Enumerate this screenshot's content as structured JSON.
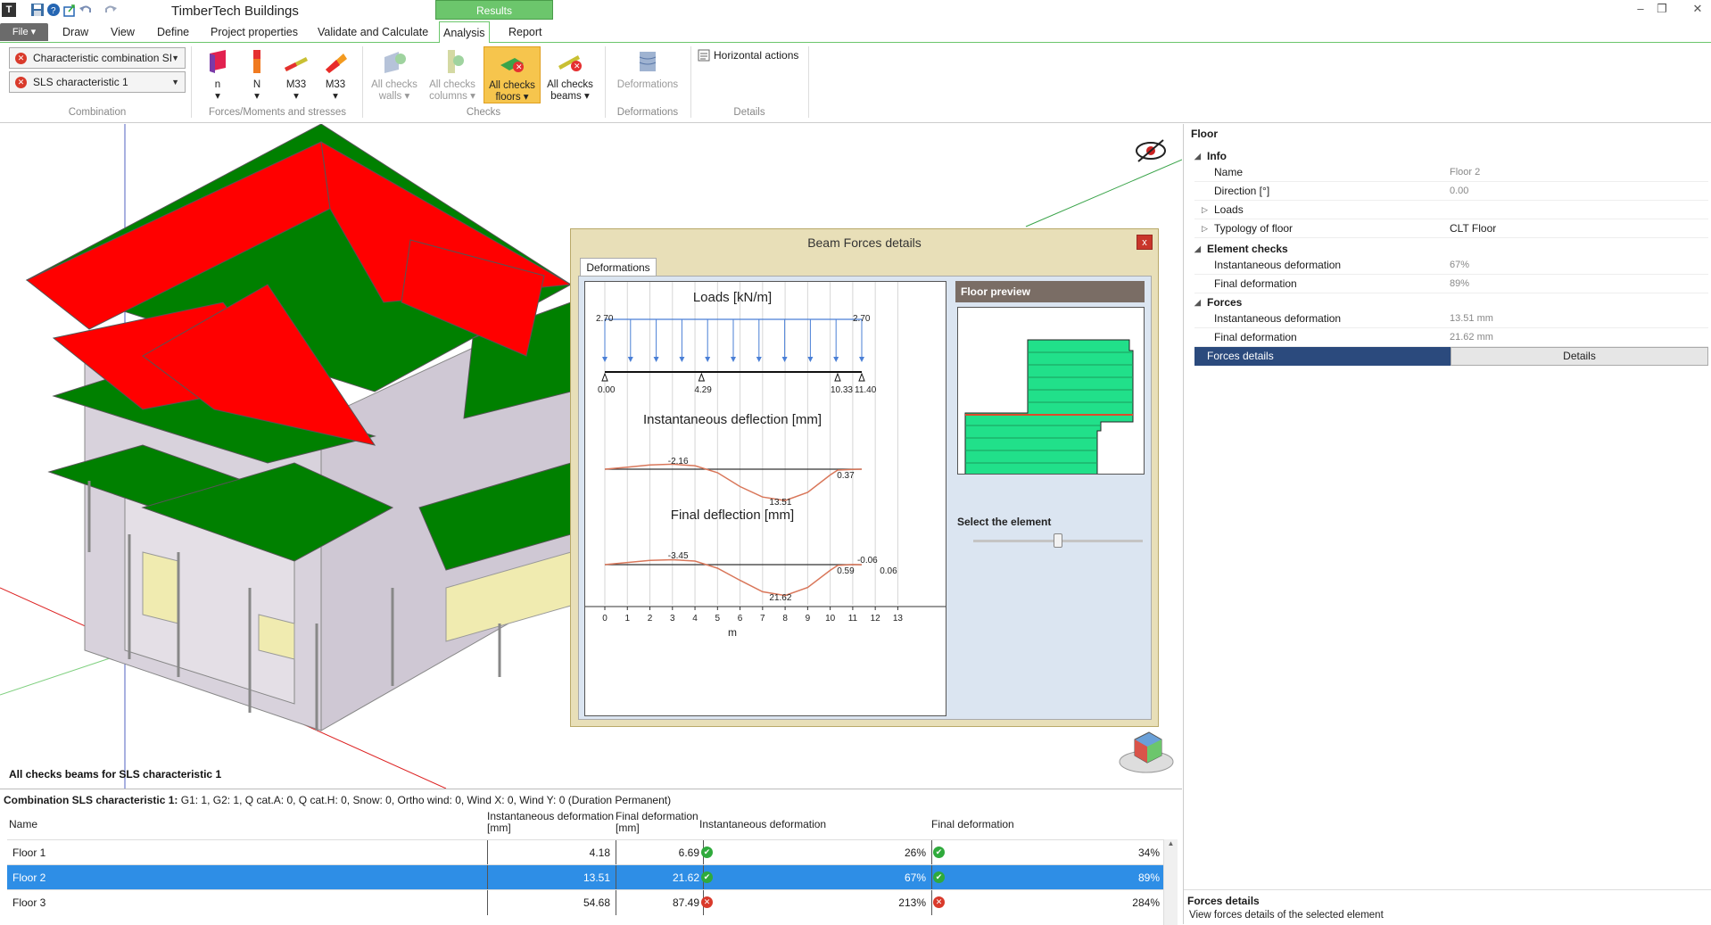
{
  "app": {
    "title": "TimberTech Buildings",
    "results_tab": "Results"
  },
  "menu": {
    "file": "File ▾",
    "tabs": [
      "Draw",
      "View",
      "Define",
      "Project properties",
      "Validate and Calculate",
      "Analysis",
      "Report"
    ],
    "active": "Analysis"
  },
  "ribbon": {
    "combination_combo": "Characteristic combination SI",
    "sls_combo": "SLS characteristic 1",
    "groups": {
      "combination": "Combination",
      "forces": "Forces/Moments and stresses",
      "checks": "Checks",
      "deformations": "Deformations",
      "details": "Details"
    },
    "buttons": {
      "n": "n",
      "N": "N",
      "m33a": "M33",
      "m33b": "M33",
      "walls_1": "All checks",
      "walls_2": "walls",
      "columns_1": "All checks",
      "columns_2": "columns",
      "floors_1": "All checks",
      "floors_2": "floors",
      "beams_1": "All checks",
      "beams_2": "beams",
      "deformations": "Deformations",
      "horizontal_actions": "Horizontal actions"
    }
  },
  "viewport": {
    "caption": "All checks beams for SLS characteristic 1"
  },
  "dialog": {
    "title": "Beam Forces details",
    "close": "x",
    "tab": "Deformations",
    "preview_title": "Floor preview",
    "select_label": "Select the element",
    "slider_value": 0.5
  },
  "chart_data": [
    {
      "type": "line",
      "title": "Loads [kN/m]",
      "x": [
        0.0,
        11.4
      ],
      "values": [
        2.7,
        2.7
      ],
      "value_labels": [
        "2.70",
        "2.70"
      ],
      "supports": [
        0.0,
        4.29,
        10.33,
        11.4
      ],
      "support_labels": [
        "0.00",
        "4.29",
        "10.33",
        "11.40"
      ]
    },
    {
      "type": "line",
      "title": "Instantaneous deflection [mm]",
      "x": [
        0,
        1,
        2,
        3,
        4,
        5,
        6,
        7,
        8,
        9,
        10,
        10.33,
        11,
        11.4
      ],
      "values": [
        0,
        -0.9,
        -1.8,
        -2.16,
        -1.5,
        1.5,
        7.5,
        12.0,
        13.51,
        10.0,
        2.5,
        0.37,
        0.1,
        0
      ],
      "annotations": [
        "-2.16",
        "13.51",
        "0.37"
      ]
    },
    {
      "type": "line",
      "title": "Final deflection [mm]",
      "x": [
        0,
        1,
        2,
        3,
        4,
        5,
        6,
        7,
        8,
        9,
        10,
        10.33,
        11,
        11.4
      ],
      "values": [
        0,
        -1.5,
        -3.0,
        -3.45,
        -2.5,
        2.5,
        11.0,
        19.0,
        21.62,
        16.0,
        4.0,
        0.59,
        -0.06,
        0.06
      ],
      "annotations": [
        "-3.45",
        "21.62",
        "0.59",
        "-0.06",
        "0.06"
      ]
    }
  ],
  "axis": {
    "ticks": [
      "1",
      "0",
      "1",
      "2",
      "3",
      "4",
      "5",
      "6",
      "7",
      "8",
      "9",
      "10",
      "11",
      "12",
      "13"
    ],
    "label": "m"
  },
  "properties": {
    "title": "Floor",
    "info": "Info",
    "name_k": "Name",
    "name_v": "Floor 2",
    "direction_k": "Direction [°]",
    "direction_v": "0.00",
    "loads_k": "Loads",
    "typology_k": "Typology of floor",
    "typology_v": "CLT Floor",
    "element_checks": "Element checks",
    "inst_def_k": "Instantaneous deformation",
    "inst_def_v": "67%",
    "final_def_k": "Final deformation",
    "final_def_v": "89%",
    "forces": "Forces",
    "f_inst_k": "Instantaneous deformation",
    "f_inst_v": "13.51 mm",
    "f_final_k": "Final deformation",
    "f_final_v": "21.62 mm",
    "forces_details_k": "Forces details",
    "details_btn": "Details",
    "footer_title": "Forces details",
    "footer_desc": "View forces details of the selected element"
  },
  "table": {
    "combo_label": "Combination SLS characteristic 1:",
    "combo_desc": "G1: 1, G2: 1, Q cat.A: 0, Q cat.H: 0, Snow: 0, Ortho wind: 0, Wind X: 0, Wind Y: 0 (Duration Permanent)",
    "headers": {
      "name": "Name",
      "inst_mm_1": "Instantaneous deformation",
      "inst_mm_2": "[mm]",
      "final_mm_1": "Final deformation",
      "final_mm_2": "[mm]",
      "inst_pct": "Instantaneous deformation",
      "final_pct": "Final deformation"
    },
    "rows": [
      {
        "name": "Floor 1",
        "inst": "4.18",
        "final": "6.69",
        "inst_pct": "26%",
        "final_pct": "34%"
      },
      {
        "name": "Floor 2",
        "inst": "13.51",
        "final": "21.62",
        "inst_pct": "67%",
        "final_pct": "89%"
      },
      {
        "name": "Floor 3",
        "inst": "54.68",
        "final": "87.49",
        "inst_pct": "213%",
        "final_pct": "284%"
      }
    ]
  },
  "colors": {
    "accent": "#6cc66c",
    "selection": "#2e8ee6",
    "roof_fail": "#ff0000",
    "floor_ok": "#008000",
    "wall": "#d8d2dc"
  }
}
